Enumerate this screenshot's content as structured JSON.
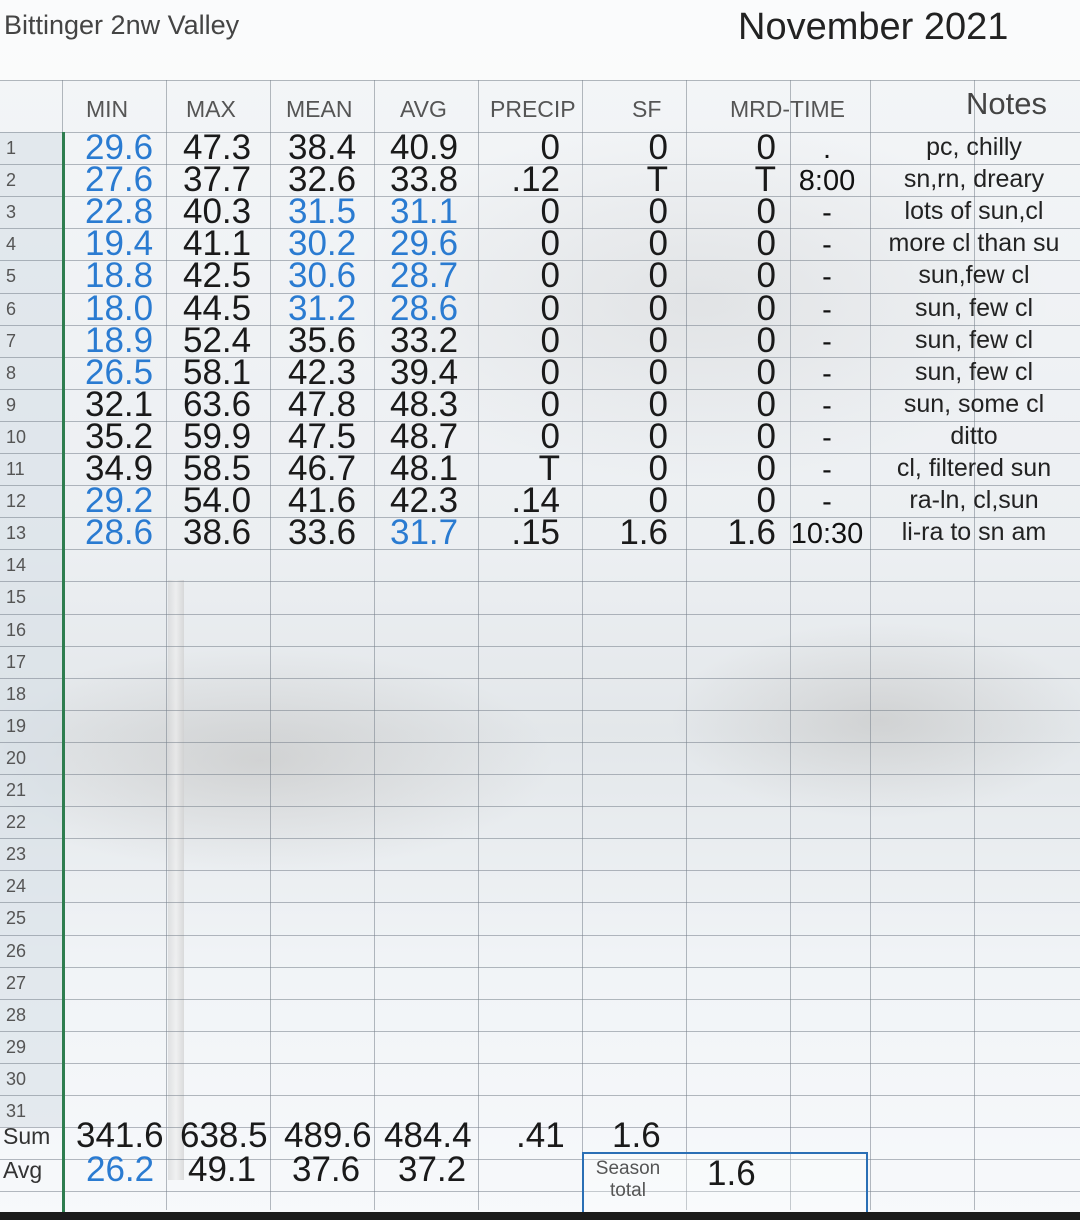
{
  "station": "Bittinger 2nw Valley",
  "month": "November 2021",
  "headers": {
    "min": "MIN",
    "max": "MAX",
    "mean": "MEAN",
    "avg": "AVG",
    "precip": "PRECIP",
    "sf": "SF",
    "mrd_time": "MRD-TIME",
    "notes": "Notes"
  },
  "colors": {
    "accent_blue": "#2a7bd1",
    "row_line": "#2e7d4f",
    "season_box": "#2a6fb5"
  },
  "rows": [
    {
      "d": "1",
      "min": "29.6",
      "min_blue": true,
      "max": "47.3",
      "mean": "38.4",
      "mean_blue": false,
      "avg": "40.9",
      "avg_blue": false,
      "precip": "0",
      "sf": "0",
      "mrd": "0",
      "time": ".",
      "note": "pc, chilly"
    },
    {
      "d": "2",
      "min": "27.6",
      "min_blue": true,
      "max": "37.7",
      "mean": "32.6",
      "mean_blue": false,
      "avg": "33.8",
      "avg_blue": false,
      "precip": ".12",
      "sf": "T",
      "mrd": "T",
      "time": "8:00",
      "note": "sn,rn, dreary"
    },
    {
      "d": "3",
      "min": "22.8",
      "min_blue": true,
      "max": "40.3",
      "mean": "31.5",
      "mean_blue": true,
      "avg": "31.1",
      "avg_blue": true,
      "precip": "0",
      "sf": "0",
      "mrd": "0",
      "time": "-",
      "note": "lots of sun,cl"
    },
    {
      "d": "4",
      "min": "19.4",
      "min_blue": true,
      "max": "41.1",
      "mean": "30.2",
      "mean_blue": true,
      "avg": "29.6",
      "avg_blue": true,
      "precip": "0",
      "sf": "0",
      "mrd": "0",
      "time": "-",
      "note": "more cl than su"
    },
    {
      "d": "5",
      "min": "18.8",
      "min_blue": true,
      "max": "42.5",
      "mean": "30.6",
      "mean_blue": true,
      "avg": "28.7",
      "avg_blue": true,
      "precip": "0",
      "sf": "0",
      "mrd": "0",
      "time": "-",
      "note": "sun,few cl"
    },
    {
      "d": "6",
      "min": "18.0",
      "min_blue": true,
      "max": "44.5",
      "mean": "31.2",
      "mean_blue": true,
      "avg": "28.6",
      "avg_blue": true,
      "precip": "0",
      "sf": "0",
      "mrd": "0",
      "time": "-",
      "note": "sun, few cl"
    },
    {
      "d": "7",
      "min": "18.9",
      "min_blue": true,
      "max": "52.4",
      "mean": "35.6",
      "mean_blue": false,
      "avg": "33.2",
      "avg_blue": false,
      "precip": "0",
      "sf": "0",
      "mrd": "0",
      "time": "-",
      "note": "sun, few cl"
    },
    {
      "d": "8",
      "min": "26.5",
      "min_blue": true,
      "max": "58.1",
      "mean": "42.3",
      "mean_blue": false,
      "avg": "39.4",
      "avg_blue": false,
      "precip": "0",
      "sf": "0",
      "mrd": "0",
      "time": "-",
      "note": "sun, few cl"
    },
    {
      "d": "9",
      "min": "32.1",
      "min_blue": false,
      "max": "63.6",
      "mean": "47.8",
      "mean_blue": false,
      "avg": "48.3",
      "avg_blue": false,
      "precip": "0",
      "sf": "0",
      "mrd": "0",
      "time": "-",
      "note": "sun, some cl"
    },
    {
      "d": "10",
      "min": "35.2",
      "min_blue": false,
      "max": "59.9",
      "mean": "47.5",
      "mean_blue": false,
      "avg": "48.7",
      "avg_blue": false,
      "precip": "0",
      "sf": "0",
      "mrd": "0",
      "time": "-",
      "note": "ditto"
    },
    {
      "d": "11",
      "min": "34.9",
      "min_blue": false,
      "max": "58.5",
      "mean": "46.7",
      "mean_blue": false,
      "avg": "48.1",
      "avg_blue": false,
      "precip": "T",
      "sf": "0",
      "mrd": "0",
      "time": "-",
      "note": "cl, filtered sun"
    },
    {
      "d": "12",
      "min": "29.2",
      "min_blue": true,
      "max": "54.0",
      "mean": "41.6",
      "mean_blue": false,
      "avg": "42.3",
      "avg_blue": false,
      "precip": ".14",
      "sf": "0",
      "mrd": "0",
      "time": "-",
      "note": "ra-ln, cl,sun"
    },
    {
      "d": "13",
      "min": "28.6",
      "min_blue": true,
      "max": "38.6",
      "mean": "33.6",
      "mean_blue": false,
      "avg": "31.7",
      "avg_blue": true,
      "precip": ".15",
      "sf": "1.6",
      "mrd": "1.6",
      "time": "10:30",
      "note": "li-ra to sn am"
    }
  ],
  "empty_days": [
    "14",
    "15",
    "16",
    "17",
    "18",
    "19",
    "20",
    "21",
    "22",
    "23",
    "24",
    "25",
    "26",
    "27",
    "28",
    "29",
    "30",
    "31"
  ],
  "sum": {
    "label": "Sum",
    "min": "341.6",
    "max": "638.5",
    "mean": "489.6",
    "avg": "484.4",
    "precip": ".41",
    "sf": "1.6"
  },
  "avg": {
    "label": "Avg",
    "min": "26.2",
    "max": "49.1",
    "mean": "37.6",
    "avg": "37.2"
  },
  "season": {
    "label": "Season total",
    "value": "1.6"
  }
}
